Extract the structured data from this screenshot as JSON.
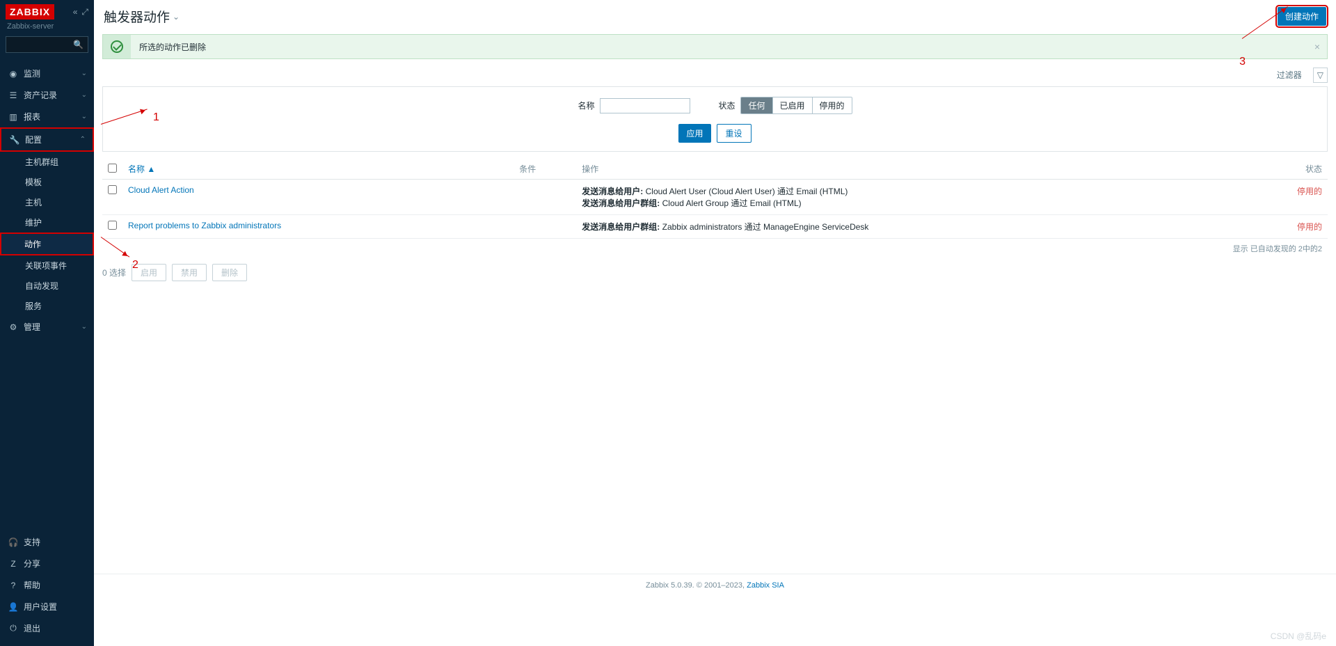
{
  "brand": "ZABBIX",
  "server_name": "Zabbix-server",
  "search_placeholder": "",
  "nav": {
    "monitor": "监测",
    "inventory": "资产记录",
    "reports": "报表",
    "config": "配置",
    "config_sub": {
      "hostgroups": "主机群组",
      "templates": "模板",
      "hosts": "主机",
      "maintenance": "维护",
      "actions": "动作",
      "correlation": "关联项事件",
      "discovery": "自动发现",
      "services": "服务"
    },
    "admin": "管理",
    "support": "支持",
    "share": "分享",
    "help": "帮助",
    "userset": "用户设置",
    "logout": "退出"
  },
  "page": {
    "title": "触发器动作",
    "create_btn": "创建动作",
    "message": "所选的动作已删除",
    "filter_label": "过滤器"
  },
  "filter": {
    "name_label": "名称",
    "name_value": "",
    "status_label": "状态",
    "status_any": "任何",
    "status_enabled": "已启用",
    "status_disabled": "停用的",
    "apply": "应用",
    "reset": "重设"
  },
  "columns": {
    "name": "名称",
    "conditions": "条件",
    "operations": "操作",
    "status": "状态"
  },
  "rows": [
    {
      "name": "Cloud Alert Action",
      "conditions": "",
      "op1_bold": "发送消息给用户:",
      "op1_rest": " Cloud Alert User (Cloud Alert User) 通过 Email (HTML)",
      "op2_bold": "发送消息给用户群组:",
      "op2_rest": " Cloud Alert Group 通过 Email (HTML)",
      "status": "停用的"
    },
    {
      "name": "Report problems to Zabbix administrators",
      "conditions": "",
      "op1_bold": "发送消息给用户群组:",
      "op1_rest": " Zabbix administrators 通过 ManageEngine ServiceDesk",
      "op2_bold": "",
      "op2_rest": "",
      "status": "停用的"
    }
  ],
  "table_footer": "显示 已自动发现的 2中的2",
  "bulk": {
    "selected": "0 选择",
    "enable": "启用",
    "disable": "禁用",
    "delete": "删除"
  },
  "footer": {
    "text1": "Zabbix 5.0.39. © 2001–2023, ",
    "link": "Zabbix SIA"
  },
  "watermark": "CSDN @乱码e",
  "annotations": {
    "n1": "1",
    "n2": "2",
    "n3": "3"
  }
}
